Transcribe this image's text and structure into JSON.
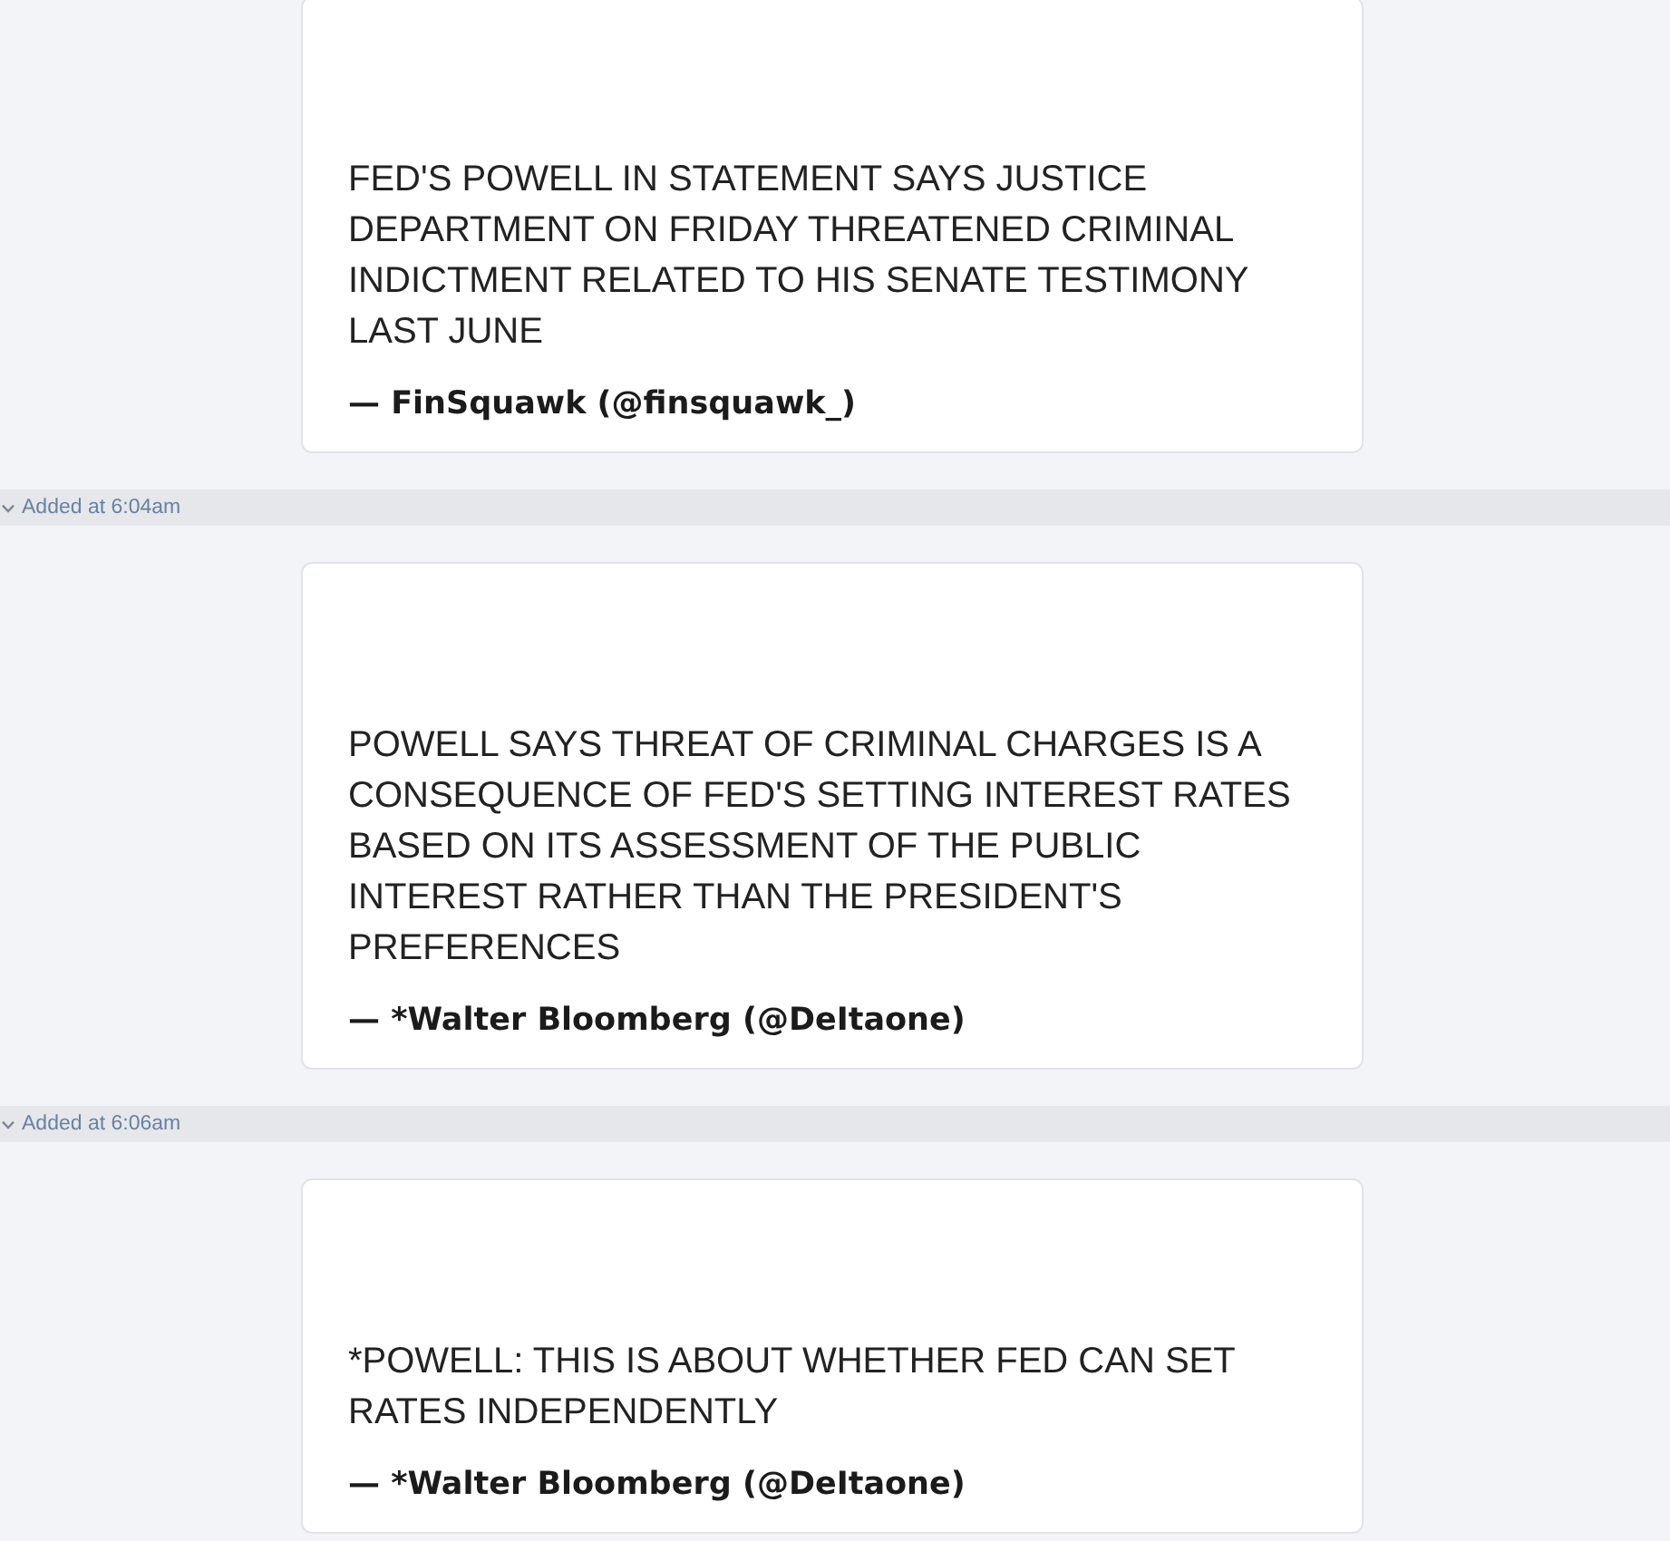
{
  "feed": [
    {
      "kind": "post",
      "text": "FED'S POWELL IN STATEMENT SAYS JUSTICE DEPARTMENT ON FRIDAY THREATENED CRIMINAL INDICTMENT RELATED TO HIS SENATE TESTIMONY LAST JUNE",
      "attribution": "— FinSquawk (@finsquawk_)"
    },
    {
      "kind": "time_divider",
      "label": "Added at 6:04am",
      "expanded": true
    },
    {
      "kind": "post",
      "text": "POWELL SAYS THREAT OF CRIMINAL CHARGES IS A CONSEQUENCE OF FED'S SETTING INTEREST RATES BASED ON ITS ASSESSMENT OF THE PUBLIC INTEREST RATHER THAN THE PRESIDENT'S PREFERENCES",
      "attribution": "— *Walter Bloomberg (@DeItaone)"
    },
    {
      "kind": "time_divider",
      "label": "Added at 6:06am",
      "expanded": true
    },
    {
      "kind": "post",
      "text": "*POWELL: THIS IS ABOUT WHETHER FED CAN SET RATES INDEPENDENTLY",
      "attribution": "— *Walter Bloomberg (@DeItaone)"
    }
  ]
}
